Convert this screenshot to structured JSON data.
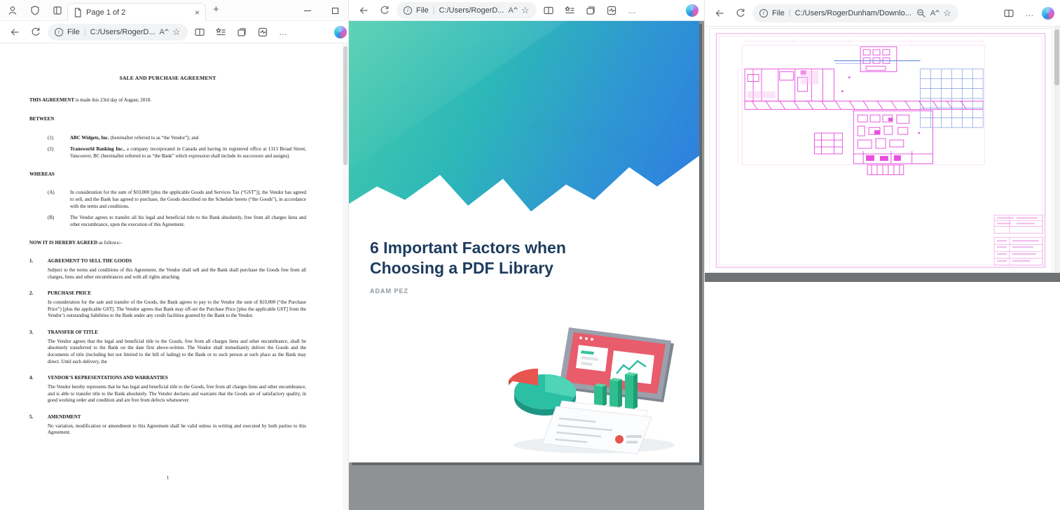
{
  "icons": {
    "close": "×",
    "new_tab": "+",
    "more": "…",
    "star": "☆",
    "read_aloud": "A",
    "info": "i",
    "divider": "|"
  },
  "left": {
    "tab_title": "Page 1 of 2",
    "address": {
      "scheme": "File",
      "path": "C:/Users/RogerD..."
    },
    "doc": {
      "title": "SALE AND PURCHASE AGREEMENT",
      "intro_bold": "THIS AGREEMENT",
      "intro_rest": " is made this 23rd day of August, 2018.",
      "between": "BETWEEN",
      "parties": [
        {
          "num": "(1)",
          "name": "ABC Widgets, Inc.",
          "rest": " (hereinafter referred to as “the Vendor”); and"
        },
        {
          "num": "(2)",
          "name": "Transworld Banking Inc.",
          "rest": ", a company incorporated in Canada and having its registered office at 1313 Broad Street, Vancouver, BC (hereinafter referred to as “the Bank” which expression shall include its successors and assigns)."
        }
      ],
      "whereas": "WHEREAS",
      "recitals": [
        {
          "num": "(A)",
          "text": "In consideration for the sum of $10,000 [plus the applicable Goods and Services Tax (“GST”)], the Vendor has agreed to sell, and the Bank has agreed to purchase, the Goods described on the Schedule hereto (“the Goods”), in accordance with the terms and conditions."
        },
        {
          "num": "(B)",
          "text": "The Vendor agrees to transfer all his legal and beneficial title to the Bank absolutely, free from all charges liens and other encumbrance, upon the execution of this Agreement."
        }
      ],
      "agreed_bold": "NOW IT IS HEREBY AGREED",
      "agreed_rest": " as follows:-",
      "sections": [
        {
          "num": "1.",
          "heading": "AGREEMENT TO SELL THE GOODS",
          "body": "Subject to the terms and conditions of this Agreement, the Vendor shall sell and the Bank shall purchase the Goods free from all charges, liens and other encumbrances and with all rights attaching."
        },
        {
          "num": "2.",
          "heading": "PURCHASE PRICE",
          "body": "In consideration for the sale and transfer of the Goods, the Bank agrees to pay to the Vendor the sum of $10,000 (“the Purchase Price”) [plus the applicable GST].  The Vendor agrees that Bank may off-set the Purchase Price [plus the applicable GST] from the Vendor’s outstanding liabilities to the Bank under any credit facilities granted by the Bank to the Vendor."
        },
        {
          "num": "3.",
          "heading": "TRANSFER OF TITLE",
          "body": "The Vendor agrees that the legal and beneficial title to the Goods, free from all charges liens and other encumbrance, shall be absolutely transferred to the Bank on the date first above-written. The Vendor shall immediately deliver the Goods and the documents of title (including but not limited to the bill of lading) to the Bank or to such person at such place as the Bank may direct.  Until such delivery, the"
        },
        {
          "num": "4.",
          "heading": "VENDOR’S REPRESENTATIONS AND WARRANTIES",
          "body": "The Vendor hereby represents that he has legal and beneficial title to the Goods, free from all charges liens and other encumbrance, and is able to transfer title to the Bank absolutely. The Vendor declares and warrants that the Goods are of satisfactory quality, in good working order and condition and are free from defects whatsoever."
        },
        {
          "num": "5.",
          "heading": "AMENDMENT",
          "body": "No variation, modification or amendment to this Agreement shall be valid unless in writing and executed by both parties to this Agreement."
        }
      ],
      "page_number": "1"
    }
  },
  "middle": {
    "address": {
      "scheme": "File",
      "path": "C:/Users/RogerD..."
    },
    "page": {
      "title_line1": "6 Important Factors when",
      "title_line2": "Choosing a PDF Library",
      "author": "ADAM PEZ"
    }
  },
  "right": {
    "address": {
      "scheme": "File",
      "path": "C:/Users/RogerDunham/Downlo..."
    }
  },
  "colors": {
    "gradient_start": "#45cbaa",
    "gradient_end": "#2f7ce2",
    "title_navy": "#1d3c5e",
    "cad_magenta": "#e231d8",
    "cad_blue": "#7d9ae0"
  }
}
